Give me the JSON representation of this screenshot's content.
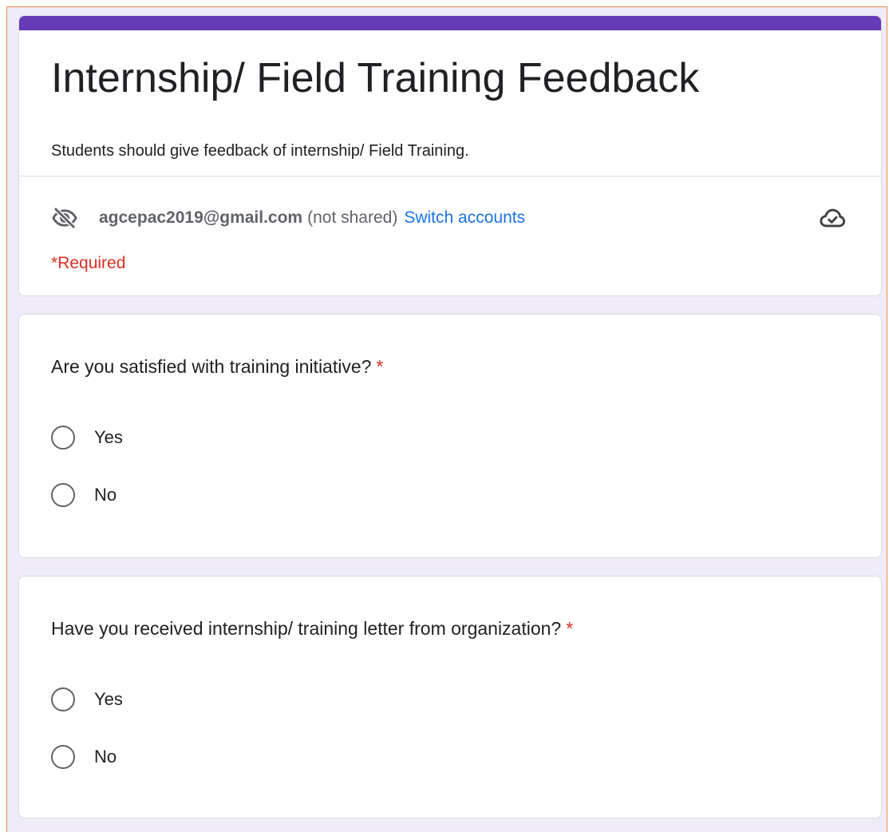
{
  "form": {
    "accent_color": "#673ab7",
    "title": "Internship/ Field Training Feedback",
    "description": "Students should give feedback of internship/ Field Training.",
    "account": {
      "email": "agcepac2019@gmail.com",
      "sharing_note": "(not shared)",
      "switch_label": "Switch accounts",
      "privacy_icon": "eye-off-icon",
      "save_status_icon": "cloud-done-icon"
    },
    "required_note": "*Required"
  },
  "questions": [
    {
      "text": "Are you satisfied with training initiative?",
      "required_marker": "*",
      "options": [
        {
          "label": "Yes",
          "selected": false
        },
        {
          "label": "No",
          "selected": false
        }
      ]
    },
    {
      "text": "Have you received internship/ training letter from organization?",
      "required_marker": "*",
      "options": [
        {
          "label": "Yes",
          "selected": false
        },
        {
          "label": "No",
          "selected": false
        }
      ]
    }
  ]
}
